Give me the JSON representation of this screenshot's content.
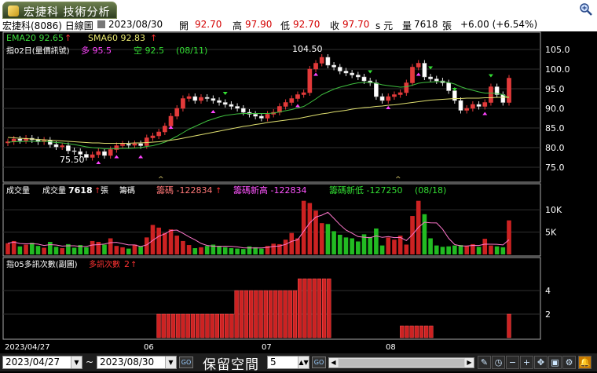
{
  "tab": {
    "title": "宏捷科 技術分析"
  },
  "info": {
    "stock": "宏捷科(8086) 日線圖",
    "date": "2023/08/30",
    "open_label": "開",
    "open": "92.70",
    "high_label": "高",
    "high": "97.90",
    "low_label": "低",
    "low": "92.70",
    "close_label": "收",
    "close": "97.70",
    "unit": "s 元",
    "vol_label": "量",
    "volume": "7618",
    "vol_unit": "張",
    "change": "+6.00 (+6.54%)"
  },
  "panel1": {
    "ema": "EMA20 92.65",
    "sma": "SMA60 92.83",
    "indicator": "指02日(量價訊號)",
    "bull_label": "多 95.5",
    "bear_label": "空 92.5",
    "bull_bear_date": "(08/11)",
    "peak_label": "104.50",
    "trough_label": "75.50",
    "y_ticks": [
      "105.0",
      "100.0",
      "95.0",
      "90.0",
      "85.0",
      "80.0",
      "75.0"
    ]
  },
  "panel2": {
    "title": "成交量",
    "vol_label": "成交量",
    "vol_value": "7618",
    "vol_unit": "張",
    "chip_label": "籌碼",
    "chip": "籌碼 -122834",
    "chip_new_high": "籌碼新高 -122834",
    "chip_new_low": "籌碼新低 -127250",
    "chip_date": "(08/18)",
    "y_ticks": [
      "10K",
      "5K"
    ]
  },
  "panel3": {
    "indicator": "指05多訊次數(副圖)",
    "count_label": "多訊次數",
    "count": "2",
    "y_ticks": [
      "4",
      "2"
    ]
  },
  "x_axis": {
    "start": "2023/04/27",
    "months": [
      "06",
      "07",
      "08"
    ]
  },
  "bottom": {
    "date_from": "2023/04/27",
    "tilde": "~",
    "date_to": "2023/08/30",
    "go_label": "GO",
    "reserve_label": "保留空間",
    "reserve_value": "5"
  },
  "colors": {
    "up": "#e23a3a",
    "down": "#ffffff",
    "ema": "#3fbf3f",
    "sma": "#e0e070",
    "bull": "#ff44ff",
    "bear": "#33dd33"
  },
  "chart_data": {
    "type": "candlestick",
    "price": {
      "close": [
        81.5,
        82.2,
        81.8,
        82.4,
        82.0,
        81.5,
        81.9,
        80.8,
        80.2,
        80.5,
        79.2,
        79.0,
        78.3,
        77.5,
        78.2,
        79.0,
        78.0,
        79.5,
        80.5,
        80.9,
        80.6,
        81.0,
        80.5,
        82.5,
        83.0,
        84.0,
        85.5,
        88.0,
        90.0,
        92.5,
        93.0,
        92.0,
        92.8,
        92.5,
        92.0,
        91.5,
        91.0,
        90.5,
        90.0,
        89.0,
        88.5,
        88.0,
        87.5,
        88.5,
        89.0,
        90.5,
        91.5,
        92.5,
        93.5,
        94.0,
        100.0,
        101.5,
        103.0,
        101.0,
        100.5,
        99.5,
        99.0,
        98.5,
        98.0,
        97.0,
        96.5,
        93.0,
        92.0,
        93.0,
        93.5,
        94.0,
        96.5,
        100.5,
        101.5,
        98.0,
        97.5,
        97.0,
        96.5,
        94.5,
        92.0,
        89.5,
        90.0,
        91.0,
        90.5,
        91.5,
        95.5,
        93.5,
        91.5,
        97.7
      ],
      "ema20": [
        81.4,
        81.5,
        81.5,
        81.6,
        81.6,
        81.6,
        81.6,
        81.5,
        81.3,
        81.2,
        81.0,
        80.8,
        80.5,
        80.2,
        80.0,
        79.9,
        79.7,
        79.7,
        79.7,
        79.8,
        79.8,
        79.9,
        80.0,
        80.3,
        80.5,
        80.9,
        81.4,
        82.1,
        82.9,
        83.8,
        84.7,
        85.4,
        86.1,
        86.8,
        87.3,
        87.8,
        88.2,
        88.4,
        88.6,
        88.7,
        88.7,
        88.7,
        88.7,
        88.7,
        88.8,
        89.1,
        89.4,
        89.7,
        90.1,
        90.5,
        91.4,
        92.4,
        93.5,
        94.2,
        94.9,
        95.4,
        95.8,
        96.2,
        96.5,
        96.6,
        96.6,
        96.4,
        96.0,
        95.8,
        95.6,
        95.4,
        95.5,
        95.9,
        96.4,
        96.6,
        96.7,
        96.8,
        96.8,
        96.6,
        96.2,
        95.5,
        95.0,
        94.6,
        94.2,
        93.9,
        93.9,
        93.8,
        93.5,
        92.65
      ],
      "sma60": [
        82.6,
        82.5,
        82.4,
        82.3,
        82.2,
        82.1,
        82.0,
        81.9,
        81.8,
        81.7,
        81.6,
        81.5,
        81.4,
        81.3,
        81.2,
        81.2,
        81.1,
        81.1,
        81.1,
        81.1,
        81.1,
        81.2,
        81.2,
        81.3,
        81.4,
        81.5,
        81.7,
        81.9,
        82.1,
        82.4,
        82.7,
        83.0,
        83.3,
        83.6,
        83.9,
        84.2,
        84.5,
        84.8,
        85.1,
        85.4,
        85.6,
        85.9,
        86.1,
        86.4,
        86.6,
        86.8,
        87.0,
        87.2,
        87.4,
        87.7,
        88.0,
        88.3,
        88.6,
        88.8,
        89.1,
        89.3,
        89.5,
        89.8,
        90.0,
        90.2,
        90.3,
        90.5,
        90.6,
        90.8,
        90.9,
        91.1,
        91.3,
        91.5,
        91.7,
        91.9,
        92.1,
        92.2,
        92.3,
        92.4,
        92.5,
        92.5,
        92.6,
        92.6,
        92.6,
        92.7,
        92.7,
        92.8,
        92.8,
        92.83
      ],
      "ylim": [
        72,
        108
      ]
    },
    "volume": {
      "ylim": [
        0,
        13000
      ],
      "values": [
        2500,
        3000,
        1800,
        2200,
        2600,
        1900,
        1500,
        2800,
        1700,
        1400,
        2300,
        1500,
        2100,
        1600,
        3000,
        2800,
        2200,
        3600,
        1900,
        1600,
        1300,
        2200,
        1800,
        3800,
        6600,
        6000,
        4800,
        5600,
        4200,
        3000,
        2100,
        1400,
        1600,
        1900,
        2200,
        1900,
        1600,
        1400,
        1300,
        1200,
        1800,
        1600,
        1300,
        1900,
        2400,
        2300,
        3300,
        4800,
        3600,
        12000,
        11500,
        9800,
        7000,
        6800,
        5200,
        4400,
        3800,
        3600,
        2900,
        4500,
        3900,
        5800,
        2000,
        3800,
        3300,
        4200,
        2200,
        8600,
        12000,
        9000,
        3600,
        2000,
        1700,
        1800,
        2000,
        2100,
        1900,
        2300,
        1700,
        3500,
        2000,
        1800,
        1600,
        7618
      ]
    },
    "bull_signals": {
      "values": [
        0,
        0,
        0,
        0,
        0,
        0,
        0,
        0,
        0,
        0,
        0,
        0,
        0,
        0,
        0,
        0,
        0,
        0,
        0,
        0,
        0,
        0,
        0,
        0,
        0,
        0,
        0,
        0,
        0,
        0,
        0,
        2,
        2,
        2,
        2,
        2,
        2,
        2,
        2,
        2,
        2,
        2,
        2,
        2,
        2,
        2,
        2,
        4,
        4,
        4,
        4,
        4,
        4,
        4,
        4,
        4,
        4,
        4,
        4,
        4,
        5,
        5,
        5,
        5,
        5,
        5,
        5,
        0,
        0,
        0,
        0,
        0,
        0,
        0,
        0,
        0,
        0,
        0,
        0,
        0,
        0,
        1,
        1,
        1,
        1,
        1,
        1,
        1,
        0,
        0,
        0,
        0,
        0,
        0,
        0,
        0,
        0,
        0,
        0,
        0,
        0,
        0,
        0,
        2
      ],
      "ylim": [
        0,
        6
      ]
    }
  }
}
